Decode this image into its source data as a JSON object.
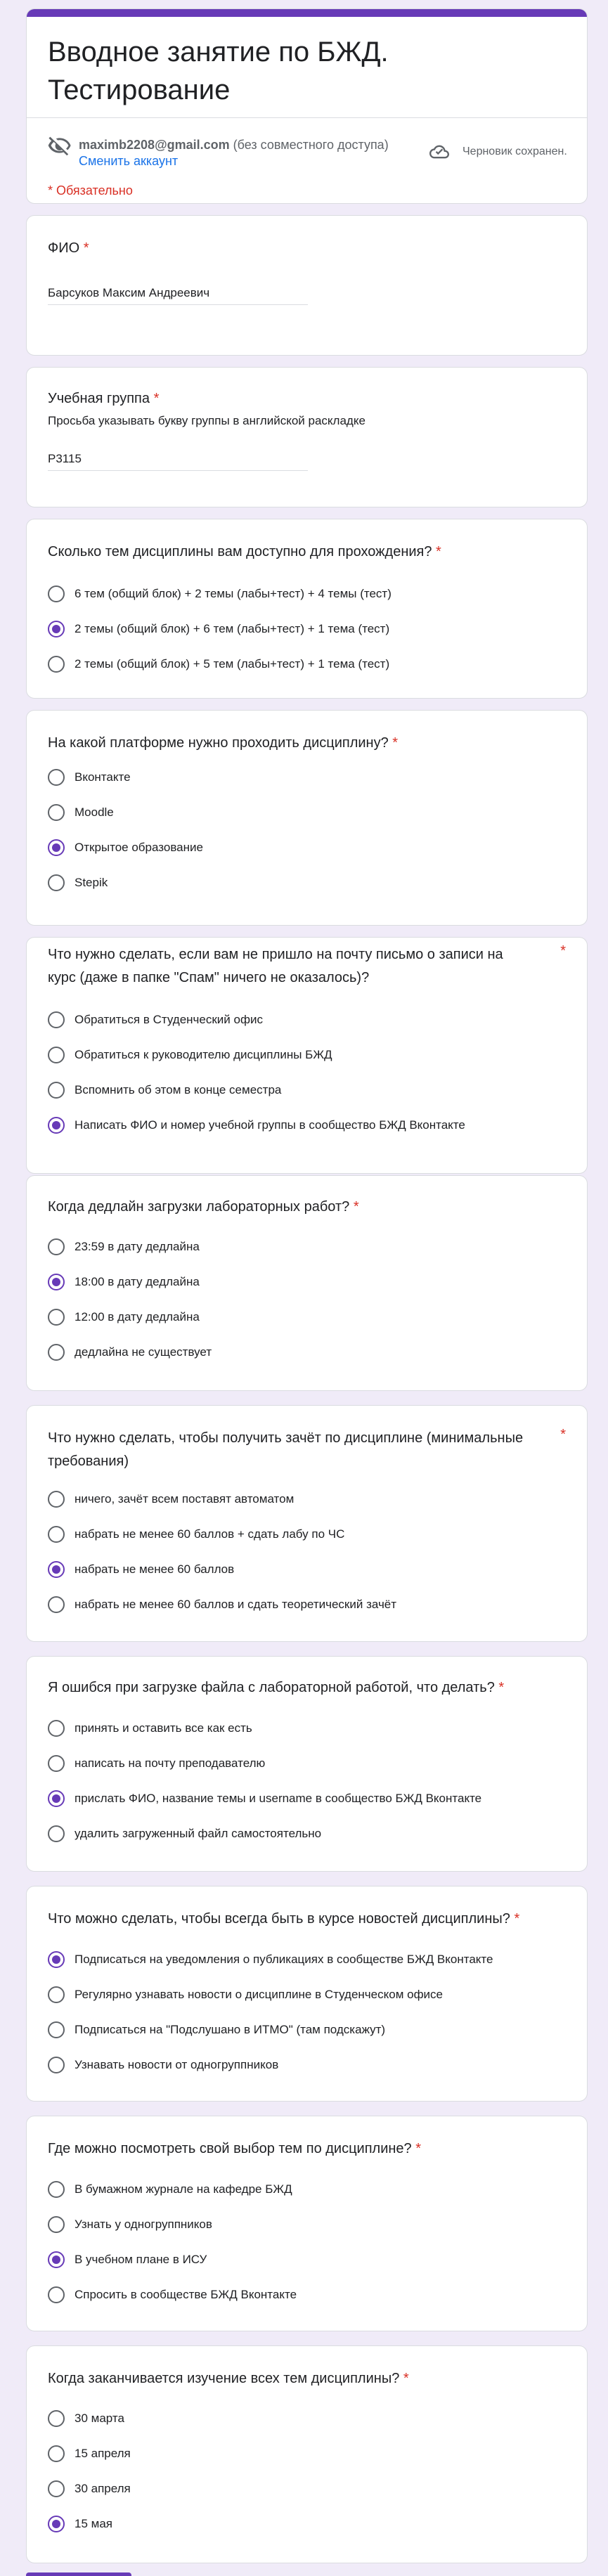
{
  "colors": {
    "accent": "#673ab7",
    "required": "#d93025",
    "link": "#1a73e8",
    "background": "#f0ebf8"
  },
  "header": {
    "title": "Вводное занятие по БЖД. Тестирование",
    "account_email": "maximb2208@gmail.com",
    "account_note": "(без совместного доступа)",
    "switch_account": "Сменить аккаунт",
    "draft_status": "Черновик сохранен.",
    "required_note": "* Обязательно",
    "icons": [
      "eye-off-icon",
      "cloud-check-icon"
    ]
  },
  "text_questions": [
    {
      "title": "ФИО",
      "required": "*",
      "description": "",
      "answer": "Барсуков Максим Андреевич"
    },
    {
      "title": "Учебная группа",
      "required": "*",
      "description": "Просьба указывать букву группы в английской раскладке",
      "answer": "P3115"
    }
  ],
  "questions": [
    {
      "title": "Сколько тем дисциплины вам доступно для прохождения?",
      "required": "*",
      "options": [
        "6 тем (общий блок) + 2 темы (лабы+тест) + 4 темы (тест)",
        "2 темы (общий блок) + 6 тем (лабы+тест) + 1 тема (тест)",
        "2 темы (общий блок) + 5 тем (лабы+тест) + 1 тема (тест)"
      ],
      "selected": 1
    },
    {
      "title": "На какой платформе нужно проходить дисциплину?",
      "required": "*",
      "options": [
        "Вконтакте",
        "Moodle",
        "Открытое образование",
        "Stepik"
      ],
      "selected": 2
    },
    {
      "title": "Что нужно сделать, если вам не пришло на почту письмо о записи на курс (даже в папке \"Спам\" ничего не оказалось)?",
      "required": "*",
      "options": [
        "Обратиться в Студенческий офис",
        "Обратиться к руководителю дисциплины БЖД",
        "Вспомнить об этом в конце семестра",
        "Написать ФИО и номер учебной группы в сообщество БЖД Вконтакте"
      ],
      "selected": 3
    },
    {
      "title": "Когда дедлайн загрузки лабораторных работ?",
      "required": "*",
      "options": [
        "23:59 в дату дедлайна",
        "18:00 в дату дедлайна",
        "12:00 в дату дедлайна",
        "дедлайна не существует"
      ],
      "selected": 1
    },
    {
      "title": "Что нужно сделать, чтобы получить зачёт по дисциплине (минимальные требования)",
      "required": "*",
      "options": [
        "ничего, зачёт всем поставят автоматом",
        "набрать не менее 60 баллов + сдать лабу по ЧС",
        "набрать не менее 60 баллов",
        "набрать не менее 60 баллов и сдать теоретический зачёт"
      ],
      "selected": 2
    },
    {
      "title": "Я ошибся при загрузке файла с лабораторной работой, что делать?",
      "required": "*",
      "options": [
        "принять и оставить все как есть",
        "написать на почту преподавателю",
        "прислать ФИО, название темы и username в сообщество БЖД Вконтакте",
        "удалить загруженный файл самостоятельно"
      ],
      "selected": 2
    },
    {
      "title": "Что можно сделать, чтобы всегда быть в курсе новостей дисциплины?",
      "required": "*",
      "options": [
        "Подписаться на уведомления о публикациях в сообществе БЖД Вконтакте",
        "Регулярно узнавать новости о дисциплине в Студенческом офисе",
        "Подписаться на \"Подслушано в ИТМО\" (там подскажут)",
        "Узнавать новости от одногруппников"
      ],
      "selected": 0
    },
    {
      "title": "Где можно посмотреть свой выбор тем по дисциплине?",
      "required": "*",
      "options": [
        "В бумажном журнале на кафедре БЖД",
        "Узнать у одногруппников",
        "В учебном плане в ИСУ",
        "Спросить в сообществе БЖД Вконтакте"
      ],
      "selected": 2
    },
    {
      "title": "Когда заканчивается изучение всех тем дисциплины?",
      "required": "*",
      "options": [
        "30 марта",
        "15 апреля",
        "30 апреля",
        "15 мая"
      ],
      "selected": 3
    }
  ]
}
